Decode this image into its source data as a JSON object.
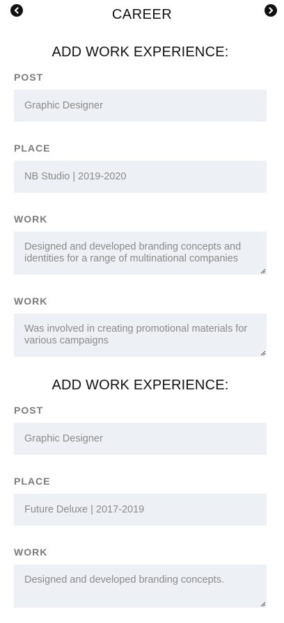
{
  "header": {
    "title": "CAREER",
    "prev_icon": "chevron-left-circle-icon",
    "next_icon": "chevron-right-circle-icon"
  },
  "experiences": [
    {
      "heading": "ADD WORK EXPERIENCE:",
      "post_label": "POST",
      "post_value": "Graphic Designer",
      "place_label": "PLACE",
      "place_value": "NB Studio | 2019-2020",
      "works": [
        {
          "label": "WORK",
          "value": "Designed and developed branding concepts and identities for a range of multinational companies"
        },
        {
          "label": "WORK",
          "value": "Was involved in creating promotional materials for various campaigns"
        }
      ]
    },
    {
      "heading": "ADD WORK EXPERIENCE:",
      "post_label": "POST",
      "post_value": "Graphic Designer",
      "place_label": "PLACE",
      "place_value": "Future Deluxe | 2017-2019",
      "works": [
        {
          "label": "WORK",
          "value": "Designed and developed branding concepts."
        }
      ]
    }
  ]
}
